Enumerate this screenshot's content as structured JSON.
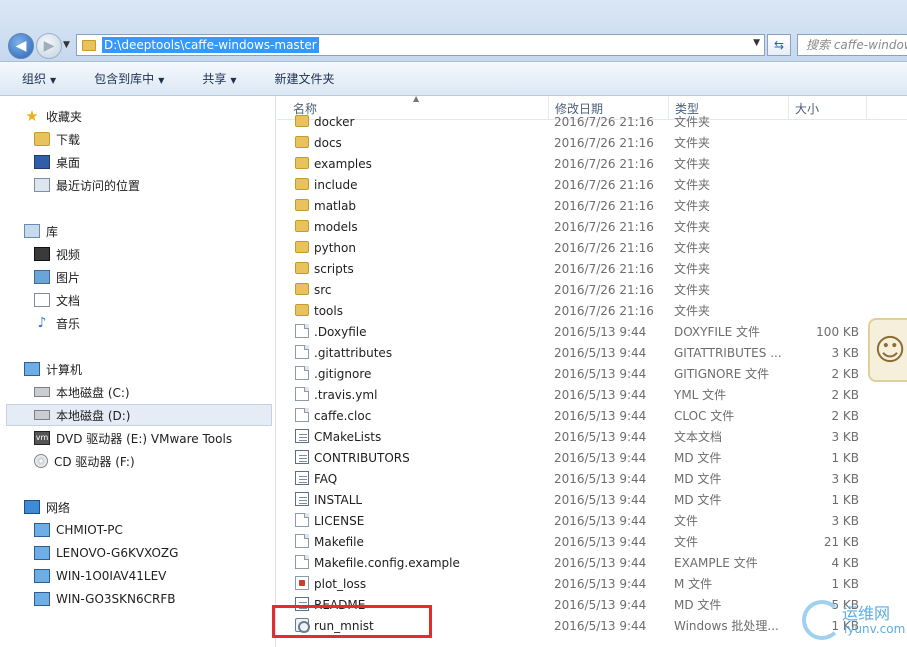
{
  "address": {
    "path": "D:\\deeptools\\caffe-windows-master",
    "search_placeholder": "搜索 caffe-windows-master"
  },
  "toolbar": {
    "organize": "组织",
    "include_in_library": "包含到库中",
    "share": "共享",
    "new_folder": "新建文件夹"
  },
  "nav": {
    "favorites": "收藏夹",
    "downloads": "下载",
    "desktop": "桌面",
    "recent": "最近访问的位置",
    "libraries": "库",
    "videos": "视频",
    "pictures": "图片",
    "documents": "文档",
    "music": "音乐",
    "computer": "计算机",
    "drive_c": "本地磁盘 (C:)",
    "drive_d": "本地磁盘 (D:)",
    "drive_e": "DVD 驱动器 (E:) VMware Tools",
    "drive_f": "CD 驱动器 (F:)",
    "network": "网络",
    "net_items": [
      "CHMIOT-PC",
      "LENOVO-G6KVXOZG",
      "WIN-1O0IAV41LEV",
      "WIN-GO3SKN6CRFB"
    ]
  },
  "columns": {
    "name": "名称",
    "date": "修改日期",
    "type": "类型",
    "size": "大小"
  },
  "files": [
    {
      "name": "docker",
      "date": "2016/7/26 21:16",
      "type": "文件夹",
      "size": "",
      "icon": "folder"
    },
    {
      "name": "docs",
      "date": "2016/7/26 21:16",
      "type": "文件夹",
      "size": "",
      "icon": "folder"
    },
    {
      "name": "examples",
      "date": "2016/7/26 21:16",
      "type": "文件夹",
      "size": "",
      "icon": "folder"
    },
    {
      "name": "include",
      "date": "2016/7/26 21:16",
      "type": "文件夹",
      "size": "",
      "icon": "folder"
    },
    {
      "name": "matlab",
      "date": "2016/7/26 21:16",
      "type": "文件夹",
      "size": "",
      "icon": "folder"
    },
    {
      "name": "models",
      "date": "2016/7/26 21:16",
      "type": "文件夹",
      "size": "",
      "icon": "folder"
    },
    {
      "name": "python",
      "date": "2016/7/26 21:16",
      "type": "文件夹",
      "size": "",
      "icon": "folder"
    },
    {
      "name": "scripts",
      "date": "2016/7/26 21:16",
      "type": "文件夹",
      "size": "",
      "icon": "folder"
    },
    {
      "name": "src",
      "date": "2016/7/26 21:16",
      "type": "文件夹",
      "size": "",
      "icon": "folder"
    },
    {
      "name": "tools",
      "date": "2016/7/26 21:16",
      "type": "文件夹",
      "size": "",
      "icon": "folder"
    },
    {
      "name": ".Doxyfile",
      "date": "2016/5/13 9:44",
      "type": "DOXYFILE 文件",
      "size": "100 KB",
      "icon": "file"
    },
    {
      "name": ".gitattributes",
      "date": "2016/5/13 9:44",
      "type": "GITATTRIBUTES ...",
      "size": "3 KB",
      "icon": "file"
    },
    {
      "name": ".gitignore",
      "date": "2016/5/13 9:44",
      "type": "GITIGNORE 文件",
      "size": "2 KB",
      "icon": "file"
    },
    {
      "name": ".travis.yml",
      "date": "2016/5/13 9:44",
      "type": "YML 文件",
      "size": "2 KB",
      "icon": "file"
    },
    {
      "name": "caffe.cloc",
      "date": "2016/5/13 9:44",
      "type": "CLOC 文件",
      "size": "2 KB",
      "icon": "file"
    },
    {
      "name": "CMakeLists",
      "date": "2016/5/13 9:44",
      "type": "文本文档",
      "size": "3 KB",
      "icon": "doc"
    },
    {
      "name": "CONTRIBUTORS",
      "date": "2016/5/13 9:44",
      "type": "MD 文件",
      "size": "1 KB",
      "icon": "doc"
    },
    {
      "name": "FAQ",
      "date": "2016/5/13 9:44",
      "type": "MD 文件",
      "size": "3 KB",
      "icon": "doc"
    },
    {
      "name": "INSTALL",
      "date": "2016/5/13 9:44",
      "type": "MD 文件",
      "size": "1 KB",
      "icon": "doc"
    },
    {
      "name": "LICENSE",
      "date": "2016/5/13 9:44",
      "type": "文件",
      "size": "3 KB",
      "icon": "file"
    },
    {
      "name": "Makefile",
      "date": "2016/5/13 9:44",
      "type": "文件",
      "size": "21 KB",
      "icon": "file"
    },
    {
      "name": "Makefile.config.example",
      "date": "2016/5/13 9:44",
      "type": "EXAMPLE 文件",
      "size": "4 KB",
      "icon": "file"
    },
    {
      "name": "plot_loss",
      "date": "2016/5/13 9:44",
      "type": "M 文件",
      "size": "1 KB",
      "icon": "mfile"
    },
    {
      "name": "README",
      "date": "2016/5/13 9:44",
      "type": "MD 文件",
      "size": "5 KB",
      "icon": "doc"
    },
    {
      "name": "run_mnist",
      "date": "2016/5/13 9:44",
      "type": "Windows 批处理...",
      "size": "1 KB",
      "icon": "bat"
    }
  ],
  "watermark": {
    "line1": "运维网",
    "line2": "iyunv.com"
  }
}
